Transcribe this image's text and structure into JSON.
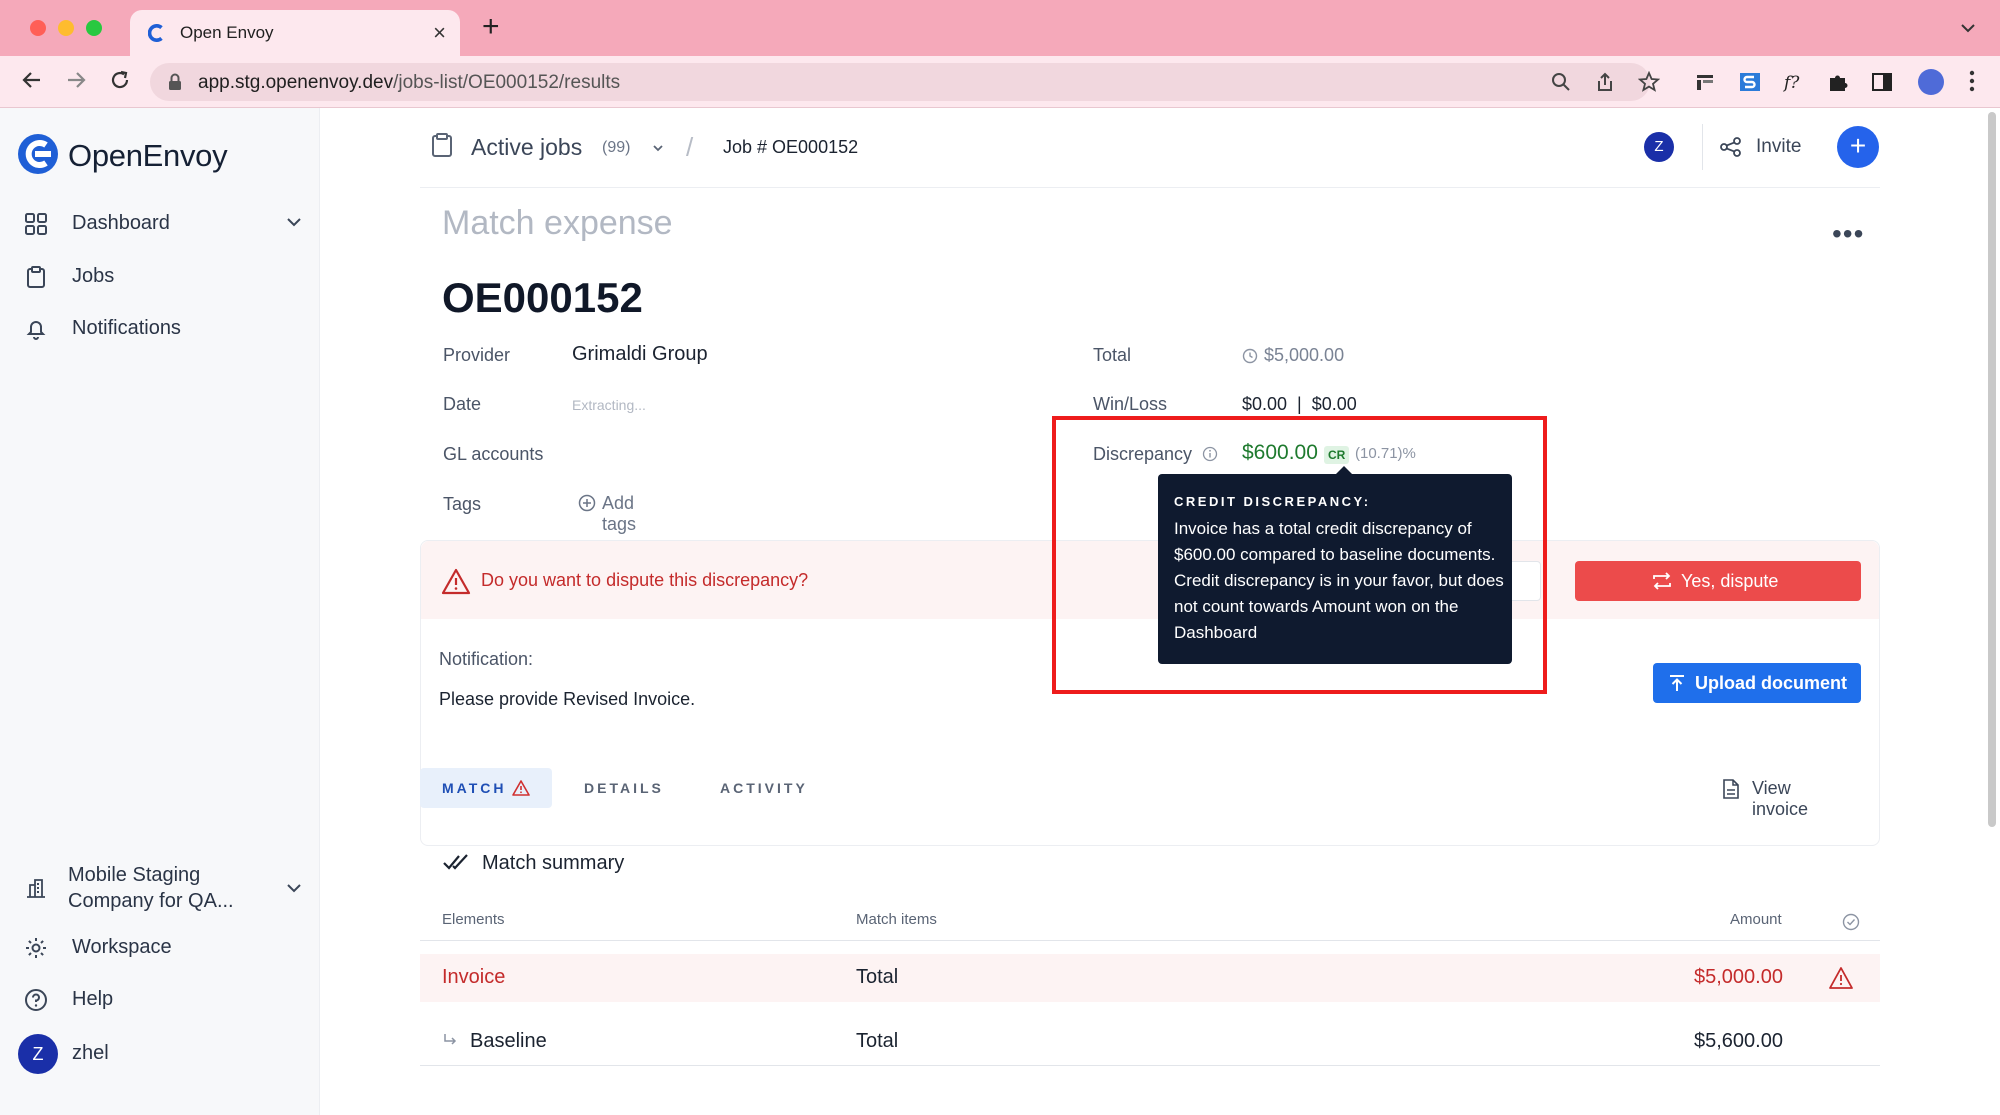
{
  "browser": {
    "tab_title": "Open Envoy",
    "url_host": "app.stg.openenvoy.dev",
    "url_path": "/jobs-list/OE000152/results"
  },
  "sidebar": {
    "logo_text": "OpenEnvoy",
    "items": [
      {
        "label": "Dashboard",
        "icon": "grid-icon"
      },
      {
        "label": "Jobs",
        "icon": "clipboard-icon"
      },
      {
        "label": "Notifications",
        "icon": "bell-icon"
      }
    ],
    "company": "Mobile Staging Company for QA...",
    "workspace": "Workspace",
    "help": "Help",
    "user_initial": "Z",
    "user_name": "zhel"
  },
  "topnav": {
    "active_jobs": "Active jobs",
    "active_jobs_count": "(99)",
    "separator": "/",
    "job_crumb": "Job # OE000152",
    "avatar_initial": "Z",
    "invite": "Invite",
    "plus": "+"
  },
  "job": {
    "subtitle": "Match expense",
    "title": "OE000152",
    "more": "•••",
    "provider_label": "Provider",
    "provider_value": "Grimaldi Group",
    "date_label": "Date",
    "date_value": "Extracting...",
    "gl_label": "GL accounts",
    "tags_label": "Tags",
    "add_tags": "Add tags",
    "total_label": "Total",
    "total_value": "$5,000.00",
    "winloss_label": "Win/Loss",
    "winloss_value": "$0.00  |  $0.00",
    "discrepancy_label": "Discrepancy",
    "discrepancy_value": "$600.00",
    "discrepancy_badge": "CR",
    "discrepancy_pct": "(10.71)%"
  },
  "dispute": {
    "question": "Do you want to dispute this discrepancy?",
    "yes_button": "Yes, dispute",
    "notification_label": "Notification:",
    "notification_text": "Please provide Revised Invoice.",
    "upload_button": "Upload document"
  },
  "tooltip": {
    "title": "CREDIT DISCREPANCY:",
    "body": "Invoice has a total credit discrepancy of $600.00 compared to baseline documents. Credit discrepancy is in your favor, but does not count towards Amount won on the Dashboard"
  },
  "tabs": {
    "match": "MATCH",
    "details": "DETAILS",
    "activity": "ACTIVITY",
    "view_invoice": "View invoice"
  },
  "match_summary": {
    "title": "Match summary",
    "columns": [
      "Elements",
      "Match items",
      "Amount"
    ],
    "rows": [
      {
        "element": "Invoice",
        "item": "Total",
        "amount": "$5,000.00",
        "status": "warning"
      },
      {
        "element": "Baseline",
        "item": "Total",
        "amount": "$5,600.00",
        "status": ""
      }
    ]
  },
  "colors": {
    "accent": "#2563eb",
    "danger": "#ec4b4b",
    "credit_green": "#1e7a2e",
    "highlight_box": "#ee1c1c"
  }
}
